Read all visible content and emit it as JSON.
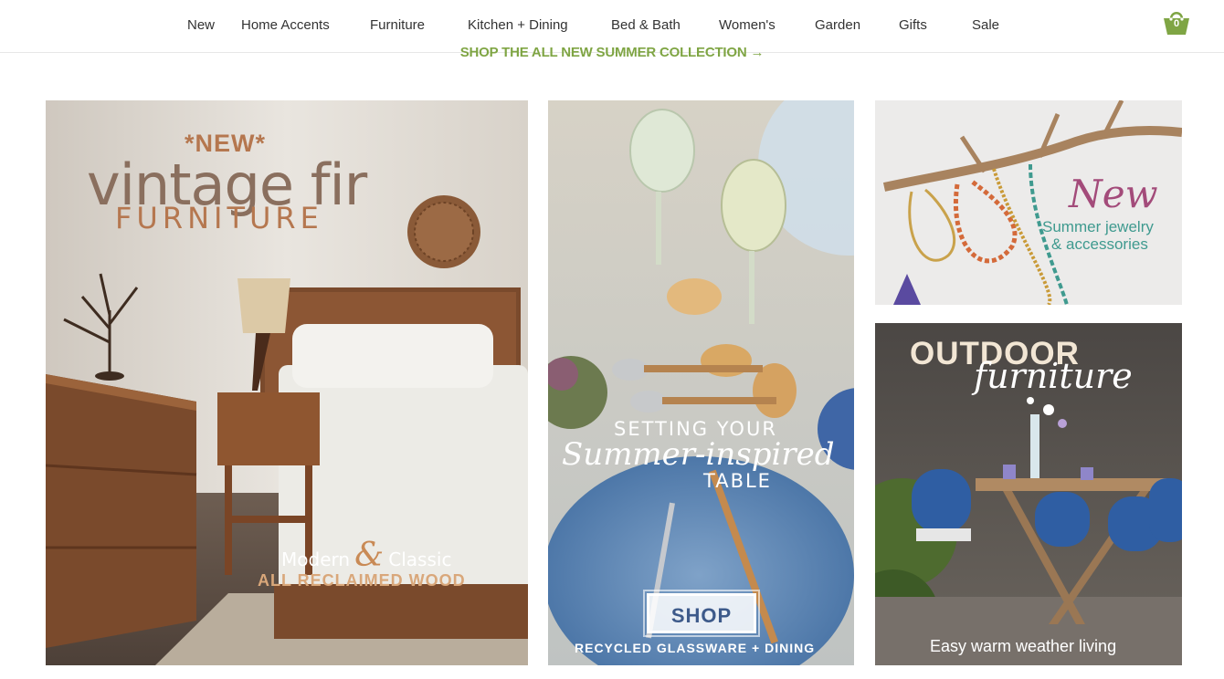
{
  "nav": {
    "items": [
      {
        "label": "New"
      },
      {
        "label": "Home Accents"
      },
      {
        "label": "Furniture"
      },
      {
        "label": "Kitchen + Dining"
      },
      {
        "label": "Bed & Bath"
      },
      {
        "label": "Women's"
      },
      {
        "label": "Garden"
      },
      {
        "label": "Gifts"
      },
      {
        "label": "Sale"
      }
    ],
    "cart_count": "0",
    "cart_icon": "basket-icon"
  },
  "promo": {
    "text": "SHOP THE ALL NEW SUMMER COLLECTION",
    "arrow": "→"
  },
  "tiles": {
    "furniture": {
      "new_label": "*NEW*",
      "title_line1": "vintage fir",
      "title_line2": "FURNITURE",
      "tag_left": "Modern",
      "tag_amp": "&",
      "tag_right": "Classic",
      "tag_line2": "ALL RECLAIMED WOOD"
    },
    "dining": {
      "line1": "SETTING YOUR",
      "line2": "Summer-inspired",
      "line3": "TABLE",
      "button": "SHOP",
      "caption": "RECYCLED GLASSWARE + DINING"
    },
    "jewelry": {
      "script": "New",
      "line1": "Summer jewelry",
      "line2": "& accessories"
    },
    "outdoor": {
      "title": "OUTDOOR",
      "script": "furniture",
      "caption": "Easy warm weather living"
    }
  },
  "colors": {
    "promo_green": "#7fa544",
    "cart_green": "#7fa544",
    "copper": "#b5774f",
    "teal": "#3f9a8f"
  }
}
